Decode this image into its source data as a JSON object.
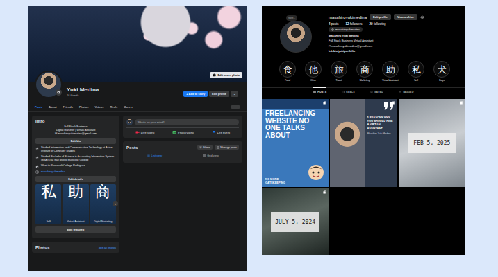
{
  "facebook": {
    "cover": {
      "button": "Edit cover photo"
    },
    "profile": {
      "name": "Yuki Medina",
      "friends": "16 friends"
    },
    "actions": [
      {
        "label": "+ Add to story",
        "primary": true
      },
      {
        "label": "Edit profile",
        "primary": false
      },
      {
        "label": "⌄",
        "primary": false
      }
    ],
    "tabs": [
      {
        "label": "Posts",
        "selected": true
      },
      {
        "label": "About",
        "selected": false
      },
      {
        "label": "Friends",
        "selected": false
      },
      {
        "label": "Photos",
        "selected": false
      },
      {
        "label": "Videos",
        "selected": false
      },
      {
        "label": "Reels",
        "selected": false
      },
      {
        "label": "More ▾",
        "selected": false
      }
    ],
    "more_menu": "···",
    "intro": {
      "title": "Intro",
      "bio": [
        "Full Stack Business",
        "Digital Marketer | Virtual Assistant",
        "✉ masahiroyukimedina@gmail.com"
      ],
      "edit_bio": "Edit bio",
      "details": [
        {
          "text": "Studied Information and Communication Technology at Asian Institute of Computer Studies",
          "kind": "study"
        },
        {
          "text": "Studied Bachelor of Science in Accounting Information System (BSAIS) at San Mateo Municipal College",
          "kind": "study"
        },
        {
          "text": "Went to Roosevelt College Rodriguez",
          "kind": "school"
        },
        {
          "text": "masahiroyukimedina",
          "kind": "instagram"
        }
      ],
      "edit_details": "Edit details",
      "featured": [
        {
          "glyph": "私",
          "label": "Self"
        },
        {
          "glyph": "助",
          "label": "Virtual Assistant"
        },
        {
          "glyph": "商",
          "label": "Digital Marketing"
        }
      ],
      "next": "›",
      "edit_featured": "Edit featured"
    },
    "photos": {
      "title": "Photos",
      "link": "See all photos"
    },
    "composer": {
      "placeholder": "What's on your mind?",
      "options": [
        {
          "label": "Live video",
          "color": "#f02849"
        },
        {
          "label": "Photo/video",
          "color": "#45bd62"
        },
        {
          "label": "Life event",
          "color": "#1877f2"
        }
      ]
    },
    "posts": {
      "title": "Posts",
      "buttons": [
        "Filters",
        "Manage posts"
      ],
      "views": [
        {
          "label": "List view",
          "selected": true
        },
        {
          "label": "Grid view",
          "selected": false
        }
      ]
    }
  },
  "instagram": {
    "note": "Note...",
    "username": "masahiroyukimedina",
    "buttons": [
      "Edit profile",
      "View archive"
    ],
    "stats": [
      {
        "count": "4",
        "label": "posts"
      },
      {
        "count": "12",
        "label": "followers"
      },
      {
        "count": "29",
        "label": "following"
      }
    ],
    "threads": "masahiroyukimedina",
    "full_name": "Masahiro Yuki Medina",
    "bio": [
      "Full Stack Business Virtual Assistant",
      "✉ masahiroyukimedina@gmail.com"
    ],
    "link": "lnk.bio/yukiportfolio",
    "highlights": [
      {
        "glyph": "食",
        "label": "Food"
      },
      {
        "glyph": "他",
        "label": "Other"
      },
      {
        "glyph": "旅",
        "label": "Travel"
      },
      {
        "glyph": "商",
        "label": "Marketing"
      },
      {
        "glyph": "助",
        "label": "Virtual Assistant"
      },
      {
        "glyph": "私",
        "label": "Self"
      },
      {
        "glyph": "犬",
        "label": "Dogs"
      }
    ],
    "tabs": [
      {
        "label": "POSTS",
        "selected": true
      },
      {
        "label": "REELS",
        "selected": false
      },
      {
        "label": "SAVED",
        "selected": false
      },
      {
        "label": "TAGGED",
        "selected": false
      }
    ],
    "posts": [
      {
        "kind": "banner",
        "title": "FREELANCING WEBSITE NO ONE TALKS ABOUT",
        "subtitle": "NO MORE GATEKEEPING"
      },
      {
        "kind": "quote",
        "title": "5 REASONS WHY YOU SHOULD HIRE A VIRTUAL ASSISTANT",
        "subtitle": "Masahiro Yuki Medina"
      },
      {
        "kind": "date",
        "title": "FEB 5, 2025"
      },
      {
        "kind": "date",
        "title": "JULY 5, 2024"
      }
    ]
  }
}
